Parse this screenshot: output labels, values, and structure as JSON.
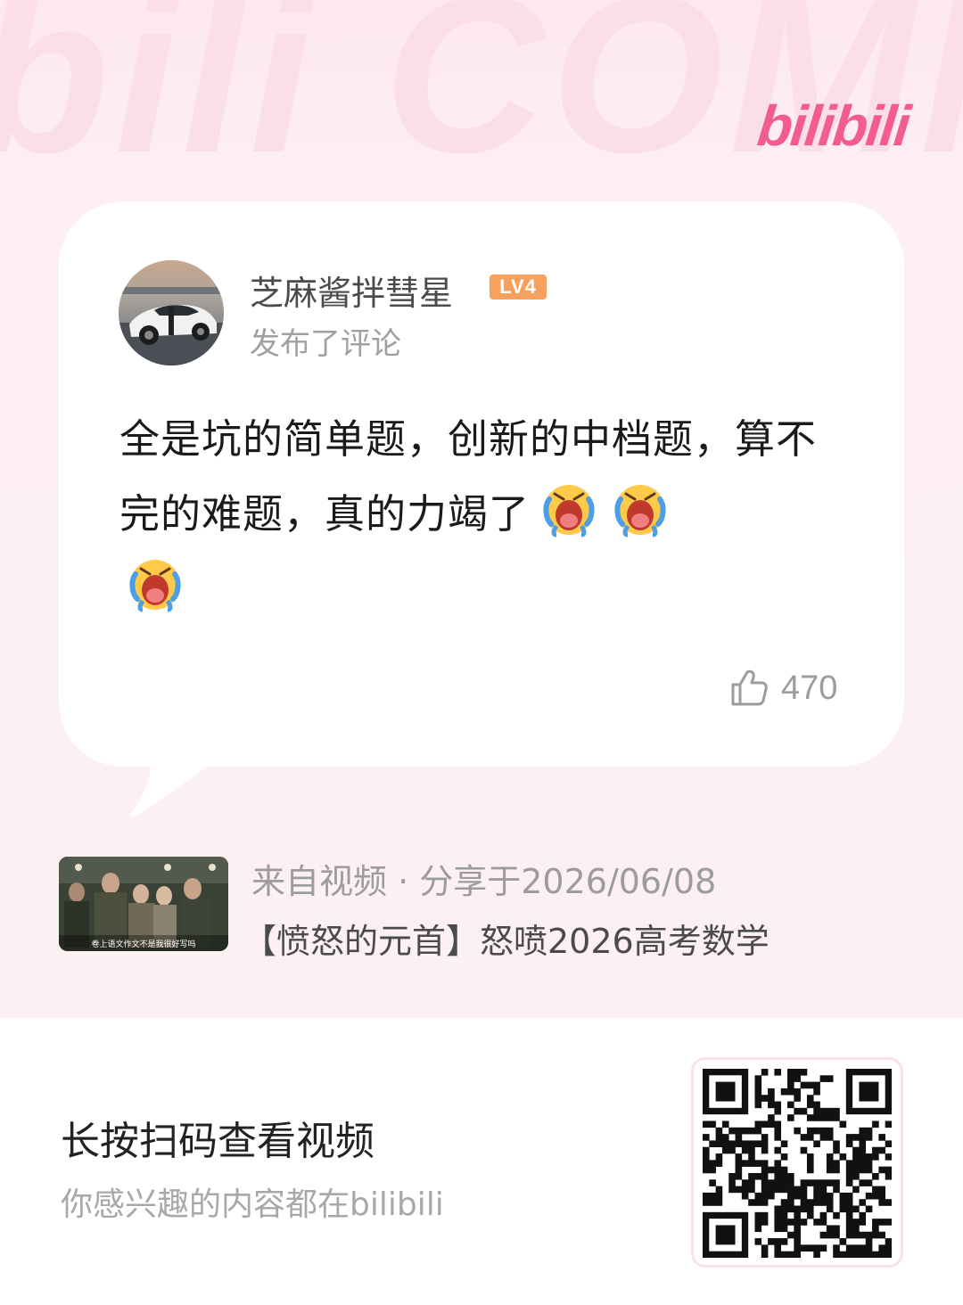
{
  "brand": {
    "logo_text": "bilibili",
    "watermark_text": "bili COMMENT",
    "accent_color": "#f25d8e",
    "level_badge_color": "#f7a15c"
  },
  "comment_card": {
    "user_name": "芝麻酱拌彗星",
    "level_badge": "LV4",
    "action_text": "发布了评论",
    "comment_text": "全是坑的简单题，创新的中档题，算不完的难题，真的力竭了",
    "emojis": [
      "crying-emoji",
      "crying-emoji",
      "crying-emoji"
    ],
    "like_icon": "thumbs-up-icon",
    "like_count": "470"
  },
  "source": {
    "source_line": "来自视频 · 分享于2026/06/08",
    "video_title": "【愤怒的元首】怒喷2026高考数学",
    "thumb_caption": "卷上语文作文不是我很好写吗"
  },
  "footer": {
    "scan_title": "长按扫码查看视频",
    "scan_subtitle": "你感兴趣的内容都在bilibili"
  }
}
